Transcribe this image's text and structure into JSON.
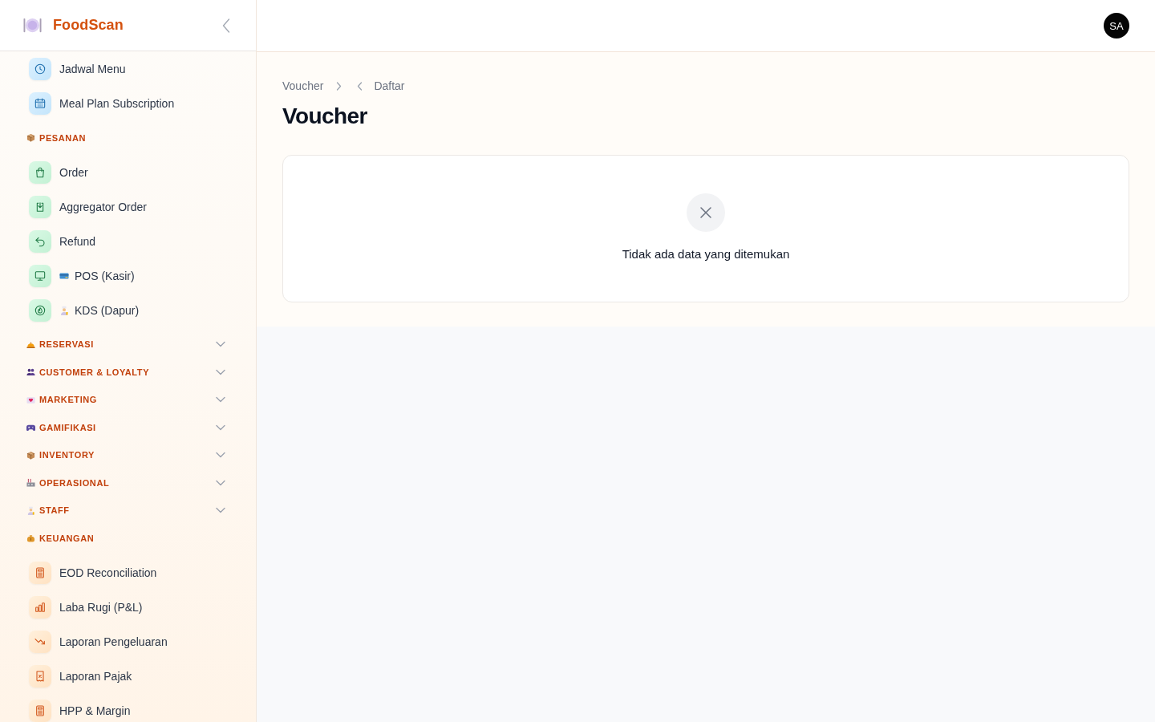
{
  "sidebar": {
    "brand": "FoodScan",
    "sections": [
      {
        "items": [
          {
            "label": "Jadwal Menu"
          },
          {
            "label": "Meal Plan Subscription"
          }
        ]
      },
      {
        "title": "PESANAN",
        "expanded": true,
        "items": [
          {
            "label": "Order"
          },
          {
            "label": "Aggregator Order"
          },
          {
            "label": "Refund"
          },
          {
            "label": "POS (Kasir)"
          },
          {
            "label": "KDS (Dapur)"
          }
        ]
      },
      {
        "title": "RESERVASI",
        "expanded": false
      },
      {
        "title": "CUSTOMER & LOYALTY",
        "expanded": false
      },
      {
        "title": "MARKETING",
        "expanded": false
      },
      {
        "title": "GAMIFIKASI",
        "expanded": false
      },
      {
        "title": "INVENTORY",
        "expanded": false
      },
      {
        "title": "OPERASIONAL",
        "expanded": false
      },
      {
        "title": "STAFF",
        "expanded": false
      },
      {
        "title": "KEUANGAN",
        "expanded": true,
        "items": [
          {
            "label": "EOD Reconciliation"
          },
          {
            "label": "Laba Rugi (P&L)"
          },
          {
            "label": "Laporan Pengeluaran"
          },
          {
            "label": "Laporan Pajak"
          },
          {
            "label": "HPP & Margin"
          }
        ]
      }
    ]
  },
  "header": {
    "avatar": "SA"
  },
  "breadcrumb": [
    "Voucher",
    "Daftar"
  ],
  "page_title": "Voucher",
  "empty_state": {
    "message": "Tidak ada data yang ditemukan"
  }
}
